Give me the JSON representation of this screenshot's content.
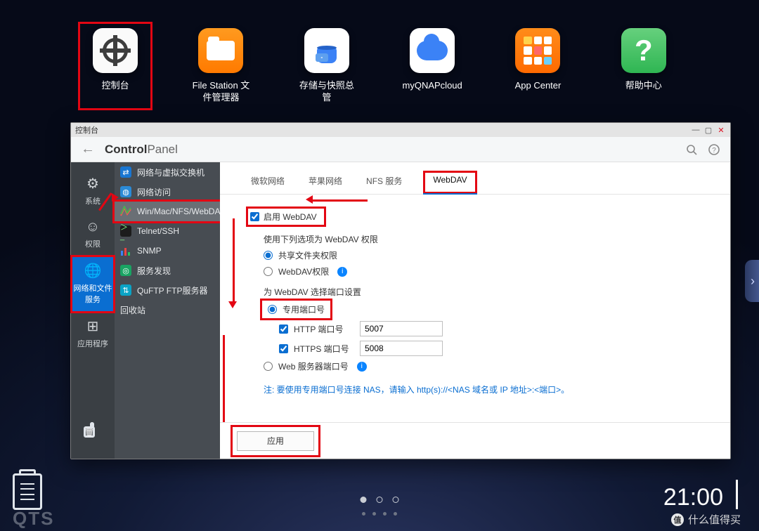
{
  "desktop": {
    "icons": [
      {
        "label": "控制台"
      },
      {
        "label": "File Station 文件管理器"
      },
      {
        "label": "存储与快照总管"
      },
      {
        "label": "myQNAPcloud"
      },
      {
        "label": "App Center"
      },
      {
        "label": "帮助中心"
      }
    ]
  },
  "window": {
    "title": "控制台",
    "header_bold": "Control",
    "header_light": "Panel"
  },
  "rail": [
    {
      "label": "系统"
    },
    {
      "label": "权限"
    },
    {
      "label": "网络和文件服务"
    },
    {
      "label": "应用程序"
    }
  ],
  "nav": [
    {
      "label": "网络与虚拟交换机"
    },
    {
      "label": "网络访问"
    },
    {
      "label": "Win/Mac/NFS/WebDAV"
    },
    {
      "label": "Telnet/SSH"
    },
    {
      "label": "SNMP"
    },
    {
      "label": "服务发现"
    },
    {
      "label": "QuFTP FTP服务器"
    },
    {
      "label": "回收站"
    }
  ],
  "tabs": [
    {
      "label": "微软网络"
    },
    {
      "label": "苹果网络"
    },
    {
      "label": "NFS 服务"
    },
    {
      "label": "WebDAV"
    }
  ],
  "form": {
    "enable": "启用 WebDAV",
    "perm_section": "使用下列选项为 WebDAV 权限",
    "perm_opt1": "共享文件夹权限",
    "perm_opt2": "WebDAV权限",
    "port_section": "为 WebDAV 选择端口设置",
    "port_opt1": "专用端口号",
    "http_label": "HTTP 端口号",
    "http_value": "5007",
    "https_label": "HTTPS 端口号",
    "https_value": "5008",
    "port_opt2": "Web 服务器端口号",
    "note": "注: 要使用专用端口号连接 NAS，请输入 http(s)://<NAS 域名或 IP 地址>:<端口>。",
    "apply": "应用"
  },
  "clock": "21:00",
  "watermark": "什么值得买",
  "brand": "QTS"
}
